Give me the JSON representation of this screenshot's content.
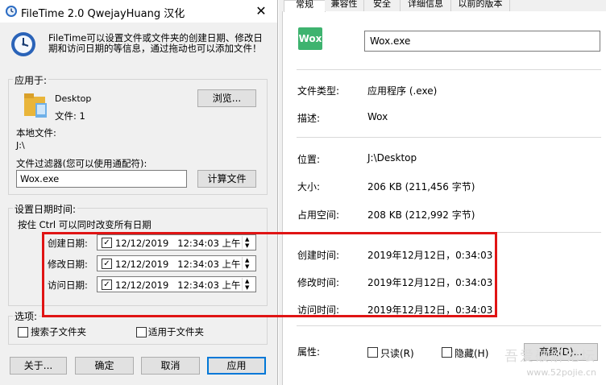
{
  "dialog": {
    "title": "FileTime 2.0   QwejayHuang 汉化",
    "description": "FileTime可以设置文件或文件夹的创建日期、修改日期和访问日期的等信息，通过拖动也可以添加文件！",
    "apply_to_label": "应用于:",
    "item_name": "Desktop",
    "item_count": "文件: 1",
    "browse_label": "浏览...",
    "local_file_label": "本地文件:",
    "local_file_path": "J:\\",
    "filter_label": "文件过滤器(您可以使用通配符):",
    "filter_value": "Wox.exe",
    "calc_label": "计算文件",
    "set_dates_label": "设置日期时间:",
    "ctrl_hint": "按住 Ctrl 可以同时改变所有日期",
    "dates": [
      {
        "label": "创建日期:",
        "value": "12/12/2019   12:34:03 上午"
      },
      {
        "label": "修改日期:",
        "value": "12/12/2019   12:34:03 上午"
      },
      {
        "label": "访问日期:",
        "value": "12/12/2019   12:34:03 上午"
      }
    ],
    "options_label": "选项:",
    "opt_subfolders": "搜索子文件夹",
    "opt_folders": "适用于文件夹",
    "about_label": "关于...",
    "ok_label": "确定",
    "cancel_label": "取消",
    "apply_label": "应用"
  },
  "props": {
    "tabs": [
      "常规",
      "兼容性",
      "安全",
      "详细信息",
      "以前的版本"
    ],
    "app_icon_text": "Wox",
    "file_name": "Wox.exe",
    "rows": [
      {
        "label": "文件类型:",
        "value": "应用程序 (.exe)"
      },
      {
        "label": "描述:",
        "value": "Wox"
      },
      {
        "label": "位置:",
        "value": "J:\\Desktop"
      },
      {
        "label": "大小:",
        "value": "206 KB (211,456 字节)"
      },
      {
        "label": "占用空间:",
        "value": "208 KB (212,992 字节)"
      },
      {
        "label": "创建时间:",
        "value": "2019年12月12日，0:34:03"
      },
      {
        "label": "修改时间:",
        "value": "2019年12月12日，0:34:03"
      },
      {
        "label": "访问时间:",
        "value": "2019年12月12日，0:34:03"
      }
    ],
    "attr_label": "属性:",
    "readonly_label": "只读(R)",
    "hidden_label": "隐藏(H)",
    "advanced_label": "高级(D)..."
  },
  "watermark": {
    "line1": "吾爱破解论坛",
    "line2": "www.52pojie.cn"
  },
  "colors": {
    "highlight": "#e01414",
    "wox_green": "#3eb36f"
  }
}
